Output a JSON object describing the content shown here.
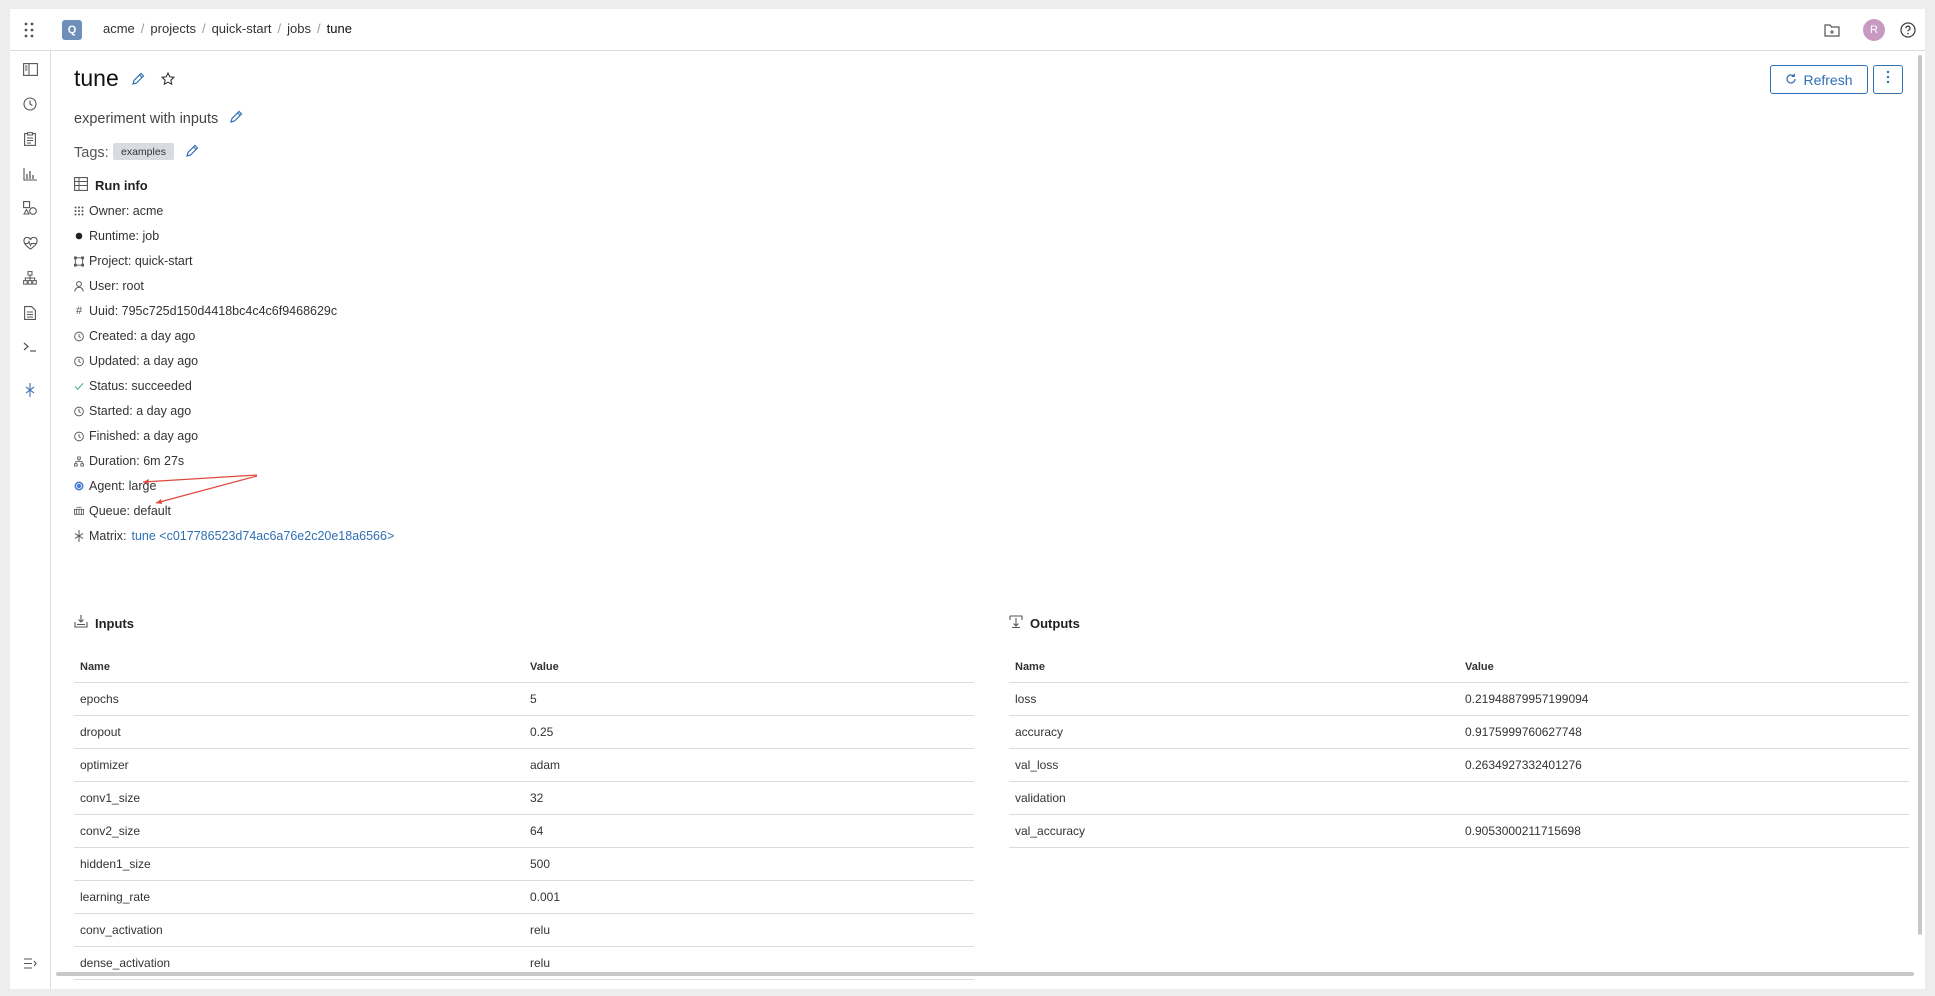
{
  "app": {
    "logo_letter": "Q",
    "avatar_letter": "R"
  },
  "breadcrumb": [
    {
      "label": "acme"
    },
    {
      "label": "projects"
    },
    {
      "label": "quick-start"
    },
    {
      "label": "jobs"
    },
    {
      "label": "tune"
    }
  ],
  "sidebar": {
    "items": [
      "columns-icon",
      "history-icon",
      "clipboard-icon",
      "chart-icon",
      "shapes-icon",
      "heart-monitor-icon",
      "hierarchy-icon",
      "document-icon",
      "terminal-icon",
      "matrix-icon"
    ],
    "bottom": "collapse-menu-icon"
  },
  "page": {
    "title": "tune",
    "description": "experiment with inputs",
    "tags_label": "Tags:",
    "tags": [
      "examples"
    ],
    "refresh_label": "Refresh"
  },
  "run_info": {
    "title": "Run info",
    "rows": [
      {
        "icon": "owner-icon",
        "text": "Owner: acme"
      },
      {
        "icon": "runtime-dot-icon",
        "text": "Runtime: job"
      },
      {
        "icon": "project-icon",
        "text": "Project: quick-start"
      },
      {
        "icon": "user-icon",
        "text": "User: root"
      },
      {
        "icon": "hash-icon",
        "text": "Uuid: 795c725d150d4418bc4c4c6f9468629c"
      },
      {
        "icon": "clock-icon",
        "text": "Created: a day ago"
      },
      {
        "icon": "clock-icon",
        "text": "Updated: a day ago"
      },
      {
        "icon": "check-icon",
        "text": "Status: succeeded"
      },
      {
        "icon": "clock-icon",
        "text": "Started: a day ago"
      },
      {
        "icon": "clock-icon",
        "text": "Finished: a day ago"
      },
      {
        "icon": "duration-icon",
        "text": "Duration: 6m 27s"
      },
      {
        "icon": "agent-icon",
        "text": "Agent: large"
      },
      {
        "icon": "queue-icon",
        "text": "Queue: default"
      }
    ],
    "matrix_label": "Matrix:",
    "matrix_link": "tune <c017786523d74ac6a76e2c20e18a6566>"
  },
  "inputs": {
    "title": "Inputs",
    "columns": [
      "Name",
      "Value"
    ],
    "rows": [
      [
        "epochs",
        "5"
      ],
      [
        "dropout",
        "0.25"
      ],
      [
        "optimizer",
        "adam"
      ],
      [
        "conv1_size",
        "32"
      ],
      [
        "conv2_size",
        "64"
      ],
      [
        "hidden1_size",
        "500"
      ],
      [
        "learning_rate",
        "0.001"
      ],
      [
        "conv_activation",
        "relu"
      ],
      [
        "dense_activation",
        "relu"
      ]
    ]
  },
  "outputs": {
    "title": "Outputs",
    "columns": [
      "Name",
      "Value"
    ],
    "rows": [
      [
        "loss",
        "0.21948879957199094"
      ],
      [
        "accuracy",
        "0.9175999760627748"
      ],
      [
        "val_loss",
        "0.2634927332401276"
      ],
      [
        "validation",
        ""
      ],
      [
        "val_accuracy",
        "0.9053000211715698"
      ]
    ]
  },
  "colors": {
    "accent": "#2f6fb5",
    "annotation_arrow": "#e0493a"
  }
}
